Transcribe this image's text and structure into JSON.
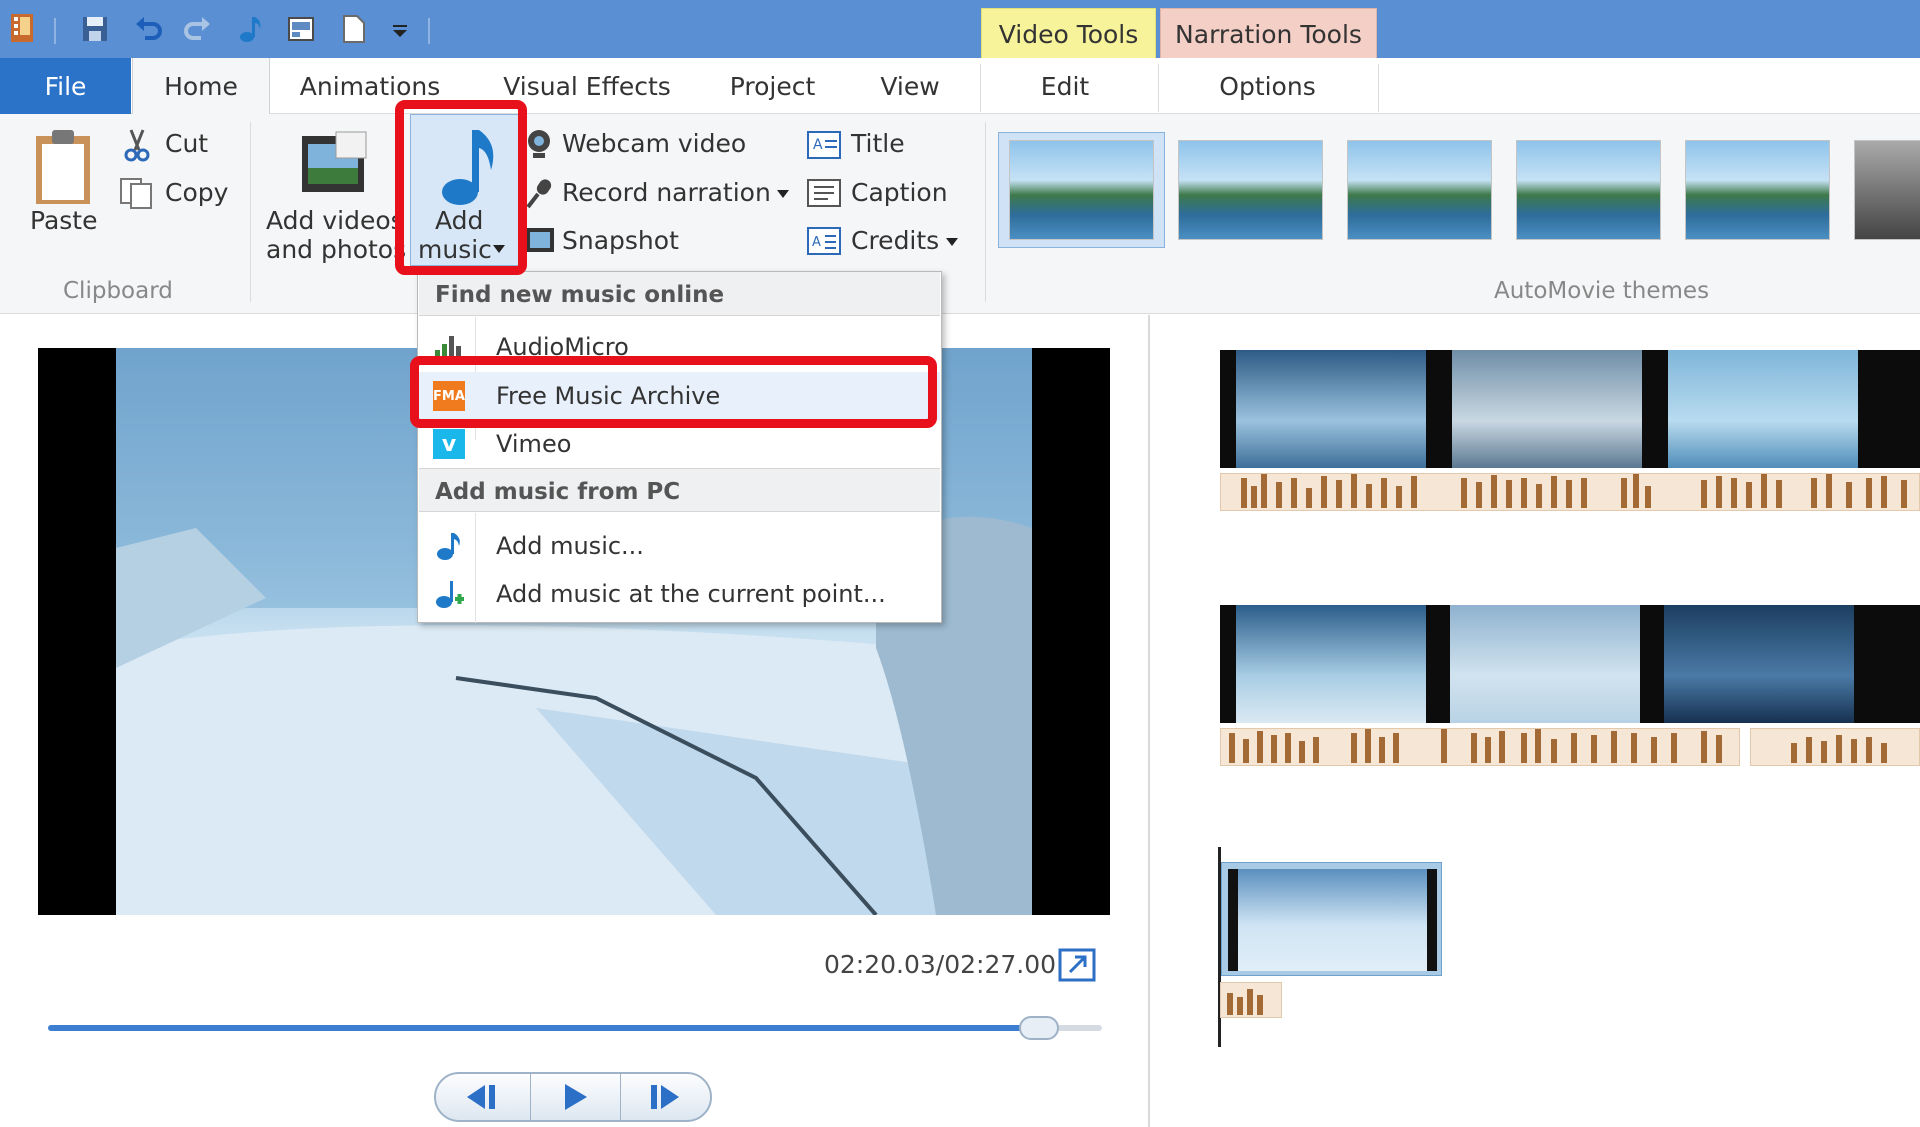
{
  "title_bar": {
    "context_tabs": {
      "video_tools": "Video Tools",
      "narration_tools": "Narration Tools"
    }
  },
  "tabs": [
    "File",
    "Home",
    "Animations",
    "Visual Effects",
    "Project",
    "View",
    "Edit",
    "Options"
  ],
  "ribbon": {
    "clipboard": {
      "paste": "Paste",
      "cut": "Cut",
      "copy": "Copy",
      "group": "Clipboard"
    },
    "add_videos": {
      "line1": "Add videos",
      "line2": "and photos"
    },
    "add_music": {
      "line1": "Add",
      "line2": "music"
    },
    "webcam": "Webcam video",
    "record_narration": "Record narration",
    "snapshot": "Snapshot",
    "title": "Title",
    "caption": "Caption",
    "credits": "Credits",
    "themes_group": "AutoMovie themes"
  },
  "dropdown": {
    "header_online": "Find new music online",
    "items_online": [
      {
        "label": "AudioMicro",
        "icon": "audiomicro-icon"
      },
      {
        "label": "Free Music Archive",
        "icon": "fma-icon",
        "badge": "FMA"
      },
      {
        "label": "Vimeo",
        "icon": "vimeo-icon",
        "badge": "v"
      }
    ],
    "header_pc": "Add music from PC",
    "items_pc": [
      {
        "label": "Add music...",
        "icon": "music-note-icon"
      },
      {
        "label": "Add music at the current point...",
        "icon": "music-add-icon"
      }
    ]
  },
  "player": {
    "time": "02:20.03/02:27.00",
    "seek_fraction": 0.94
  },
  "colors": {
    "highlight": "#e8101a",
    "file_tab": "#2b73c9",
    "titlebar": "#5a8fd4"
  }
}
